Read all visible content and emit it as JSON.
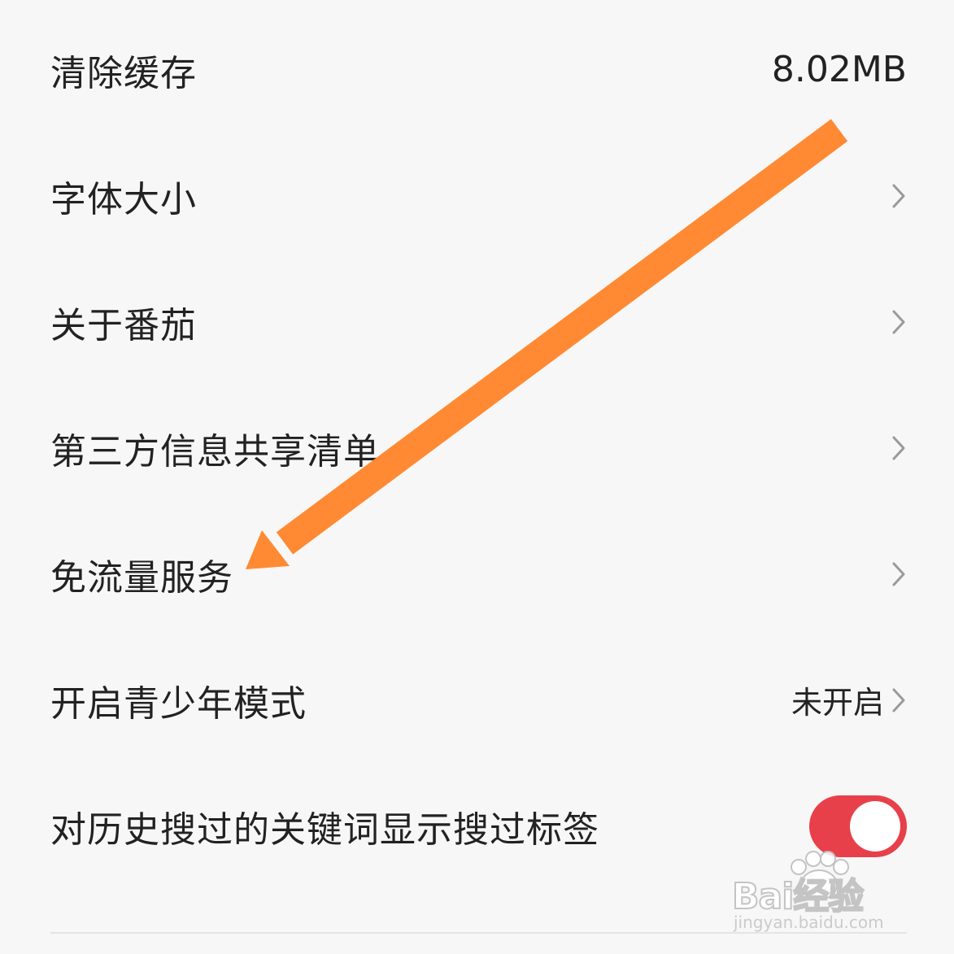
{
  "settings": {
    "clear_cache": {
      "label": "清除缓存",
      "value": "8.02MB"
    },
    "font_size": {
      "label": "字体大小"
    },
    "about": {
      "label": "关于番茄"
    },
    "third_party_sharing": {
      "label": "第三方信息共享清单"
    },
    "free_data_service": {
      "label": "免流量服务"
    },
    "youth_mode": {
      "label": "开启青少年模式",
      "state": "未开启"
    },
    "search_history_tag": {
      "label": "对历史搜过的关键词显示搜过标签",
      "enabled": true
    }
  },
  "watermark": {
    "logo": "Bai经验",
    "url": "jingyan.baidu.com"
  },
  "colors": {
    "background": "#f7f7f7",
    "text": "#222222",
    "chevron": "#9a9a9a",
    "toggle_on": "#e8404a",
    "annotation_arrow": "#ff8a33"
  },
  "icons": {
    "chevron": "chevron-right-icon",
    "annotation": "arrow-annotation-icon"
  }
}
